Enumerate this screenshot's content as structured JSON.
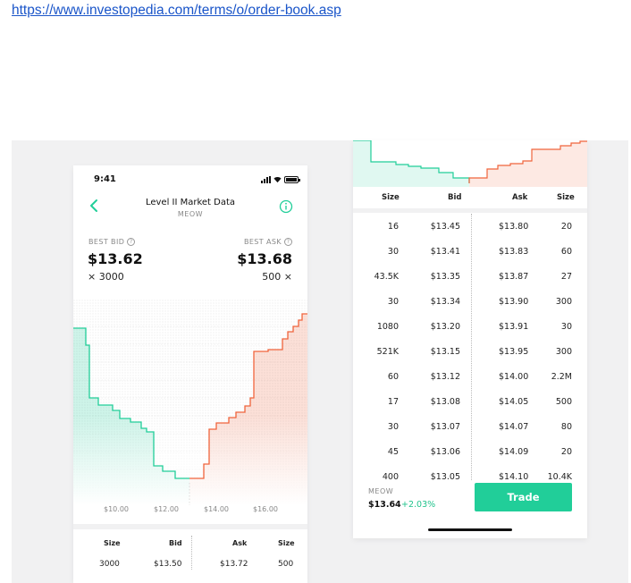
{
  "url_text": "https://www.investopedia.com/terms/o/order-book.asp",
  "left_phone": {
    "status_time": "9:41",
    "title": "Level II Market Data",
    "symbol": "MEOW",
    "best_bid_label": "BEST BID",
    "best_ask_label": "BEST ASK",
    "best_bid_price": "$13.62",
    "best_ask_price": "$13.68",
    "bid_size": "× 3000",
    "ask_size": "500 ×",
    "x_axis_labels": [
      "$10.00",
      "$12.00",
      "$14.00",
      "$16.00"
    ],
    "table_headers": [
      "Size",
      "Bid",
      "Ask",
      "Size"
    ],
    "first_row": [
      "3000",
      "$13.50",
      "$13.72",
      "500"
    ]
  },
  "right_phone": {
    "table_headers": [
      "Size",
      "Bid",
      "Ask",
      "Size"
    ],
    "rows": [
      [
        "16",
        "$13.45",
        "$13.80",
        "20"
      ],
      [
        "30",
        "$13.41",
        "$13.83",
        "60"
      ],
      [
        "43.5K",
        "$13.35",
        "$13.87",
        "27"
      ],
      [
        "30",
        "$13.34",
        "$13.90",
        "300"
      ],
      [
        "1080",
        "$13.20",
        "$13.91",
        "30"
      ],
      [
        "521K",
        "$13.15",
        "$13.95",
        "300"
      ],
      [
        "60",
        "$13.12",
        "$14.00",
        "2.2M"
      ],
      [
        "17",
        "$13.08",
        "$14.05",
        "500"
      ],
      [
        "30",
        "$13.07",
        "$14.07",
        "80"
      ],
      [
        "45",
        "$13.06",
        "$14.09",
        "20"
      ],
      [
        "400",
        "$13.05",
        "$14.10",
        "10.4K"
      ]
    ],
    "footer_symbol": "MEOW",
    "footer_price": "$13.64",
    "footer_change": "+2.03%",
    "trade_label": "Trade"
  },
  "colors": {
    "bid_green": "#21ce99",
    "ask_red": "#f0643c",
    "link_blue": "#1a55c9"
  }
}
